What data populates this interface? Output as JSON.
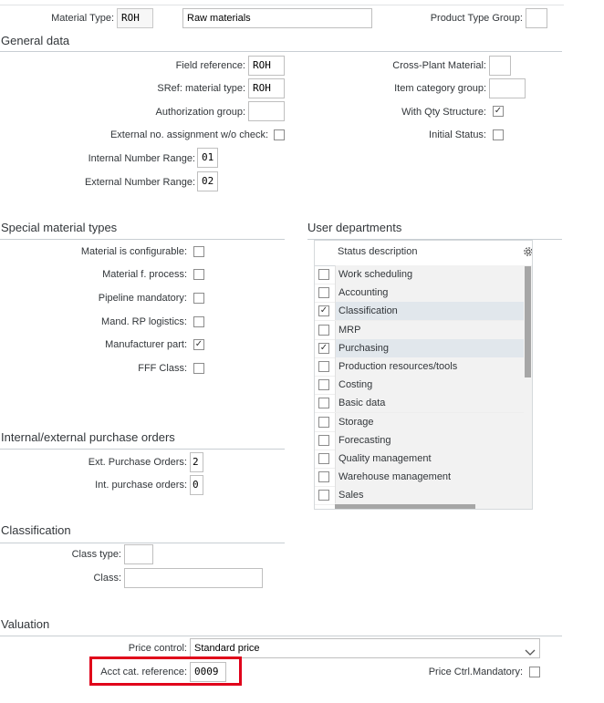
{
  "header": {
    "material_type_label": "Material Type:",
    "material_type_value": "ROH",
    "material_type_desc": "Raw materials",
    "product_type_group_label": "Product Type Group:",
    "product_type_group_value": ""
  },
  "general": {
    "title": "General data",
    "field_reference_label": "Field reference:",
    "field_reference_value": "ROH",
    "sref_label": "SRef: material type:",
    "sref_value": "ROH",
    "auth_group_label": "Authorization group:",
    "auth_group_value": "",
    "ext_no_assign_label": "External no. assignment w/o check:",
    "ext_no_assign_checked": false,
    "int_number_range_label": "Internal Number Range:",
    "int_number_range_value": "01",
    "ext_number_range_label": "External Number Range:",
    "ext_number_range_value": "02",
    "cross_plant_label": "Cross-Plant Material:",
    "cross_plant_value": "",
    "item_cat_group_label": "Item category group:",
    "item_cat_group_value": "",
    "with_qty_label": "With Qty Structure:",
    "with_qty_checked": true,
    "initial_status_label": "Initial Status:",
    "initial_status_checked": false
  },
  "special": {
    "title": "Special material types",
    "items": [
      {
        "label": "Material is configurable:",
        "checked": false
      },
      {
        "label": "Material f. process:",
        "checked": false
      },
      {
        "label": "Pipeline mandatory:",
        "checked": false
      },
      {
        "label": "Mand. RP logistics:",
        "checked": false
      },
      {
        "label": "Manufacturer part:",
        "checked": true
      },
      {
        "label": "FFF Class:",
        "checked": false
      }
    ]
  },
  "user_departments": {
    "title": "User departments",
    "column_header": "Status description",
    "settings_icon": "gear-icon",
    "rows": [
      {
        "label": "Work scheduling",
        "checked": false
      },
      {
        "label": "Accounting",
        "checked": false
      },
      {
        "label": "Classification",
        "checked": true
      },
      {
        "label": "MRP",
        "checked": false
      },
      {
        "label": "Purchasing",
        "checked": true
      },
      {
        "label": "Production resources/tools",
        "checked": false
      },
      {
        "label": "Costing",
        "checked": false
      },
      {
        "label": "Basic data",
        "checked": false
      },
      {
        "label": "Storage",
        "checked": false
      },
      {
        "label": "Forecasting",
        "checked": false
      },
      {
        "label": "Quality management",
        "checked": false
      },
      {
        "label": "Warehouse management",
        "checked": false
      },
      {
        "label": "Sales",
        "checked": false
      }
    ]
  },
  "purchase_orders": {
    "title": "Internal/external purchase orders",
    "ext_label": "Ext. Purchase Orders:",
    "ext_value": "2",
    "int_label": "Int. purchase orders:",
    "int_value": "0"
  },
  "classification": {
    "title": "Classification",
    "class_type_label": "Class type:",
    "class_type_value": "",
    "class_label": "Class:",
    "class_value": ""
  },
  "valuation": {
    "title": "Valuation",
    "price_control_label": "Price control:",
    "price_control_value": "Standard price",
    "acct_cat_label": "Acct cat. reference:",
    "acct_cat_value": "0009",
    "price_ctrl_mandatory_label": "Price Ctrl.Mandatory:",
    "price_ctrl_mandatory_checked": false
  },
  "colors": {
    "highlight_box": "#e0001a",
    "selected_row": "#e1e7ec"
  }
}
